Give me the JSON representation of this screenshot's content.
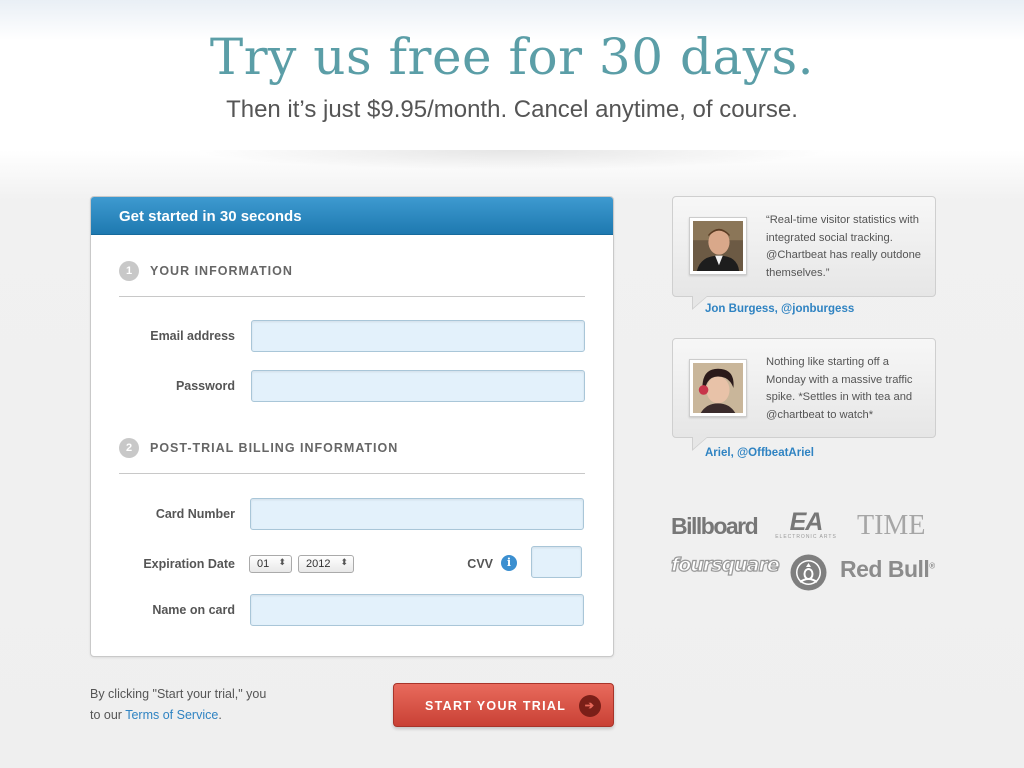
{
  "hero": {
    "headline": "Try us free for 30 days.",
    "subline": "Then it’s just $9.95/month. Cancel anytime, of course."
  },
  "form": {
    "header": "Get started in 30 seconds",
    "section1": {
      "number": "1",
      "title": "YOUR INFORMATION"
    },
    "email": {
      "label": "Email address",
      "value": "",
      "placeholder": ""
    },
    "password": {
      "label": "Password",
      "value": "",
      "placeholder": ""
    },
    "section2": {
      "number": "2",
      "title": "POST-TRIAL BILLING INFORMATION"
    },
    "card_number": {
      "label": "Card Number",
      "value": "",
      "placeholder": ""
    },
    "expiration": {
      "label": "Expiration Date",
      "month": "01",
      "year": "2012"
    },
    "cvv": {
      "label": "CVV",
      "value": ""
    },
    "name_on_card": {
      "label": "Name on card",
      "value": "",
      "placeholder": ""
    }
  },
  "terms": {
    "text": "By clicking \"Start your trial,\" you",
    "prefix": "to our",
    "link": "Terms of Service",
    "suffix": "."
  },
  "cta": {
    "label": "START YOUR TRIAL"
  },
  "testimonials": [
    {
      "quote": "“Real-time visitor statistics with integrated social tracking. @Chartbeat has really outdone themselves.”",
      "author": "Jon Burgess, @jonburgess"
    },
    {
      "quote": "Nothing like starting off a Monday with a massive traffic spike. *Settles in with tea and @chartbeat to watch*",
      "author": "Ariel, @OffbeatAriel"
    }
  ],
  "logos": {
    "billboard": "Billboard",
    "ea": "EA",
    "ea_sub": "ELECTRONIC ARTS",
    "time": "TIME",
    "foursquare": "foursquare",
    "redbull": "Red Bull",
    "redbull_mark": "®"
  },
  "colors": {
    "headline": "#5b9ea7",
    "panel_header": "#1e79b0",
    "cta": "#c94135",
    "link": "#2f83c2",
    "input_bg": "#e3f1fb"
  }
}
